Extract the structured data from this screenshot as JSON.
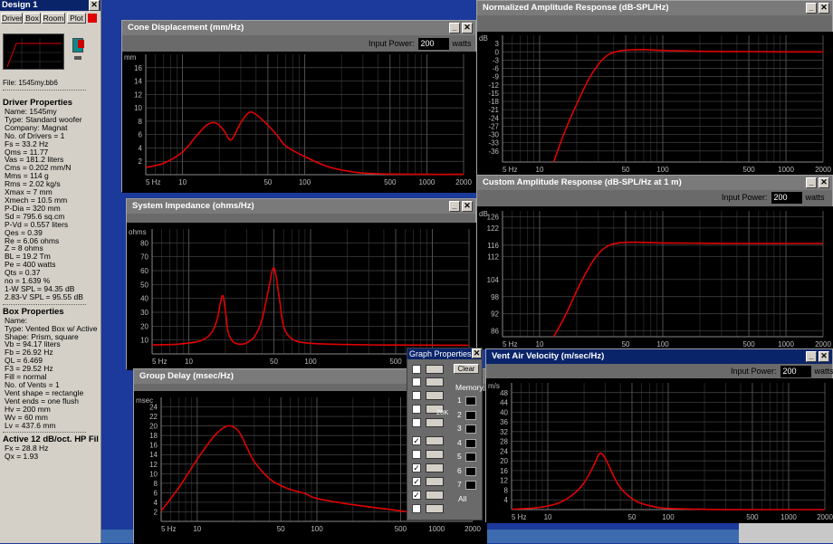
{
  "left": {
    "title": "Design 1",
    "tabs": [
      "Driver",
      "Box",
      "Room",
      "Plot"
    ],
    "file": "File: 1545my.bb6",
    "sections": [
      {
        "h": "Driver Properties",
        "lines": [
          "Name: 1545my",
          "Type: Standard woofer",
          "Company: Magnat",
          "No. of Drivers = 1",
          "Fs = 33.2 Hz",
          "Qms = 11.77",
          "Vas = 181.2 liters",
          "Cms = 0.202 mm/N",
          "Mms = 114 g",
          "Rms = 2.02 kg/s",
          "Xmax = 7 mm",
          "Xmech = 10.5 mm",
          "P-Dia = 320 mm",
          "Sd = 795.6 sq.cm",
          "P-Vd = 0.557 liters",
          "Qes = 0.39",
          "Re = 6.06 ohms",
          "Z = 8 ohms",
          "BL = 19.2 Tm",
          "Pe = 400 watts",
          "Qts = 0.37",
          "no = 1.639 %",
          "1-W SPL = 94.35 dB",
          "2.83-V SPL = 95.55 dB"
        ]
      },
      {
        "h": "Box Properties",
        "lines": [
          "Name:",
          "Type: Vented Box w/ Active",
          "Shape: Prism, square",
          "Vb = 94.17 liters",
          "Fb = 26.92 Hz",
          "QL = 6.469",
          "F3 = 29.52 Hz",
          "Fill = normal",
          "No. of Vents = 1",
          "  Vent shape = rectangle",
          "  Vent ends = one flush",
          "  Hv = 200 mm",
          "  Wv = 60 mm",
          "  Lv = 437.6 mm"
        ]
      },
      {
        "h": "Active 12 dB/oct. HP Fil",
        "lines": [
          "Fx = 28.8 Hz",
          "Qx = 1.93"
        ]
      }
    ]
  },
  "windows": {
    "cone": {
      "title": "Cone Displacement (mm/Hz)",
      "input_label": "Input Power:",
      "input_value": "200",
      "unit": "watts",
      "yunit": "mm"
    },
    "imp": {
      "title": "System Impedance (ohms/Hz)",
      "yunit": "ohms"
    },
    "gd": {
      "title": "Group Delay (msec/Hz)",
      "yunit": "msec"
    },
    "norm": {
      "title": "Normalized Amplitude Response (dB-SPL/Hz)",
      "yunit": "dB"
    },
    "cust": {
      "title": "Custom Amplitude Response (dB-SPL/Hz at 1 m)",
      "input_label": "Input Power:",
      "input_value": "200",
      "unit": "watts",
      "yunit": "dB"
    },
    "vent": {
      "title": "Vent Air Velocity (m/sec/Hz)",
      "input_label": "Input Power:",
      "input_value": "200",
      "unit": "watts",
      "yunit": "m/s"
    }
  },
  "graph_props": {
    "title": "Graph Properties",
    "clear": "Clear",
    "memory": "Memory",
    "slots": [
      "1",
      "2",
      "3",
      "4",
      "5",
      "6",
      "7"
    ],
    "all": "All",
    "label_20k": "20K"
  },
  "chart_data": [
    {
      "type": "line",
      "title": "Cone Displacement (mm/Hz)",
      "ylabel": "mm",
      "xlog": true,
      "xlim": [
        5,
        2000
      ],
      "ylim": [
        0,
        18
      ],
      "yticks": [
        2,
        4,
        6,
        8,
        10,
        12,
        14,
        16
      ],
      "xticks": [
        "5 Hz",
        "10",
        "50",
        "100",
        "500",
        "1000",
        "2000"
      ],
      "x": [
        5,
        7,
        10,
        13,
        16,
        19,
        22,
        25,
        30,
        35,
        40,
        50,
        60,
        70,
        100,
        150,
        200,
        300,
        500,
        1000,
        2000
      ],
      "y": [
        1.1,
        1.7,
        3.4,
        5.8,
        7.5,
        7.7,
        6.5,
        5.2,
        7.8,
        9.3,
        9.0,
        7.4,
        5.8,
        4.3,
        2.7,
        1.3,
        0.7,
        0.25,
        0.1,
        0.05,
        0.05
      ],
      "color": "#e00000"
    },
    {
      "type": "line",
      "title": "System Impedance (ohms/Hz)",
      "ylabel": "ohms",
      "xlog": true,
      "xlim": [
        5,
        2000
      ],
      "ylim": [
        0,
        90
      ],
      "yticks": [
        10,
        20,
        30,
        40,
        50,
        60,
        70,
        80
      ],
      "xticks": [
        "5 Hz",
        "10",
        "50",
        "100",
        "500",
        "1000",
        "2000"
      ],
      "x": [
        5,
        8,
        12,
        15,
        17,
        18,
        19,
        20,
        21,
        23,
        26,
        30,
        35,
        40,
        45,
        50,
        55,
        60,
        70,
        90,
        150,
        300,
        500,
        1000,
        2000
      ],
      "y": [
        6.5,
        7,
        9,
        14,
        24,
        35,
        42,
        31,
        16,
        9,
        7,
        8,
        13,
        25,
        46,
        62,
        42,
        20,
        11,
        8,
        7,
        6.5,
        6.4,
        6.3,
        6.2
      ],
      "color": "#e00000"
    },
    {
      "type": "line",
      "title": "Group Delay (msec/Hz)",
      "ylabel": "msec",
      "xlog": true,
      "xlim": [
        5,
        2000
      ],
      "ylim": [
        0,
        26
      ],
      "yticks": [
        2,
        4,
        6,
        8,
        10,
        12,
        14,
        16,
        18,
        20,
        22,
        24
      ],
      "xticks": [
        "5 Hz",
        "10",
        "50",
        "100",
        "500",
        "1000",
        "2000"
      ],
      "x": [
        5,
        7,
        10,
        14,
        18,
        22,
        26,
        30,
        40,
        50,
        60,
        80,
        100,
        200,
        500,
        1000,
        2000
      ],
      "y": [
        2.2,
        7,
        13,
        18,
        20,
        19,
        15.5,
        12.5,
        9,
        7.5,
        6.7,
        5.8,
        4.8,
        3.5,
        2.2,
        1.3,
        0.9
      ],
      "color": "#e00000"
    },
    {
      "type": "line",
      "title": "Normalized Amplitude Response (dB-SPL/Hz)",
      "ylabel": "dB",
      "xlog": true,
      "xlim": [
        5,
        2000
      ],
      "ylim": [
        -40,
        6
      ],
      "yticks": [
        3,
        0,
        -3,
        -6,
        -9,
        -12,
        -15,
        -18,
        -21,
        -24,
        -27,
        -30,
        -33,
        -36
      ],
      "xticks": [
        "5 Hz",
        "10",
        "50",
        "100",
        "500",
        "1000",
        "2000"
      ],
      "x": [
        13,
        16,
        20,
        25,
        30,
        35,
        40,
        50,
        70,
        100,
        200,
        500,
        1000,
        2000
      ],
      "y": [
        -40,
        -29,
        -19,
        -10,
        -4.5,
        -1.5,
        -0.2,
        0.6,
        0.8,
        0.5,
        0.2,
        0.1,
        0,
        0
      ],
      "color": "#e00000"
    },
    {
      "type": "line",
      "title": "Custom Amplitude Response (dB-SPL/Hz at 1 m)",
      "ylabel": "dB",
      "xlog": true,
      "xlim": [
        5,
        2000
      ],
      "ylim": [
        84,
        128
      ],
      "yticks": [
        126,
        122,
        116,
        112,
        104,
        98,
        92,
        86
      ],
      "xticks": [
        "5 Hz",
        "10",
        "50",
        "100",
        "500",
        "1000",
        "2000"
      ],
      "x": [
        13,
        16,
        20,
        25,
        30,
        35,
        40,
        50,
        70,
        100,
        200,
        500,
        1000,
        2000
      ],
      "y": [
        84,
        91,
        100,
        108,
        113,
        115.5,
        116.5,
        117,
        117,
        116.8,
        116.7,
        116.6,
        116.6,
        116.6
      ],
      "color": "#e00000"
    },
    {
      "type": "line",
      "title": "Vent Air Velocity (m/sec/Hz)",
      "ylabel": "m/s",
      "xlog": true,
      "xlim": [
        5,
        2000
      ],
      "ylim": [
        0,
        52
      ],
      "yticks": [
        4,
        8,
        12,
        16,
        20,
        24,
        28,
        32,
        36,
        40,
        44,
        48
      ],
      "xticks": [
        "5 Hz",
        "10",
        "50",
        "100",
        "500",
        "1000",
        "2000"
      ],
      "x": [
        5,
        8,
        12,
        16,
        20,
        24,
        27,
        30,
        35,
        40,
        50,
        60,
        80,
        100,
        200,
        500,
        2000
      ],
      "y": [
        0.2,
        0.7,
        2.5,
        6,
        11,
        18,
        23,
        21,
        14,
        9,
        4.5,
        2.5,
        1,
        0.5,
        0.1,
        0,
        0
      ],
      "color": "#e00000"
    }
  ]
}
